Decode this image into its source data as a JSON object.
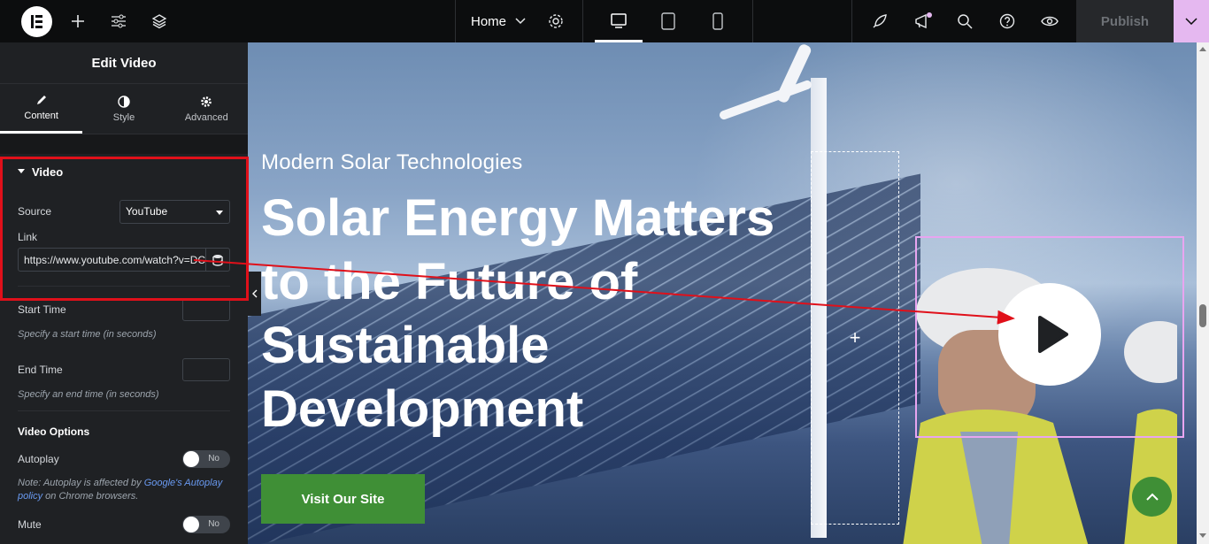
{
  "topbar": {
    "page_name": "Home",
    "publish_label": "Publish"
  },
  "panel": {
    "title": "Edit Video",
    "tabs": [
      {
        "label": "Content"
      },
      {
        "label": "Style"
      },
      {
        "label": "Advanced"
      }
    ],
    "section_video": "Video",
    "source_label": "Source",
    "source_value": "YouTube",
    "link_label": "Link",
    "link_value": "https://www.youtube.com/watch?v=DC",
    "start_time_label": "Start Time",
    "start_time_hint": "Specify a start time (in seconds)",
    "end_time_label": "End Time",
    "end_time_hint": "Specify an end time (in seconds)",
    "video_options_label": "Video Options",
    "autoplay_label": "Autoplay",
    "autoplay_toggle": "No",
    "autoplay_note_prefix": "Note: Autoplay is affected by ",
    "autoplay_note_link": "Google's Autoplay policy",
    "autoplay_note_suffix": " on Chrome browsers.",
    "mute_label": "Mute",
    "mute_toggle": "No"
  },
  "canvas": {
    "subheading": "Modern Solar Technologies",
    "heading": "Solar Energy Matters to the Future of Sustainable Development",
    "cta_label": "Visit Our Site",
    "drop_zone_plus": "+"
  },
  "colors": {
    "accent_red": "#e0101a",
    "cta_green": "#3f8f36",
    "video_frame": "#e8a5f0",
    "publish_more": "#e5b8f0"
  }
}
